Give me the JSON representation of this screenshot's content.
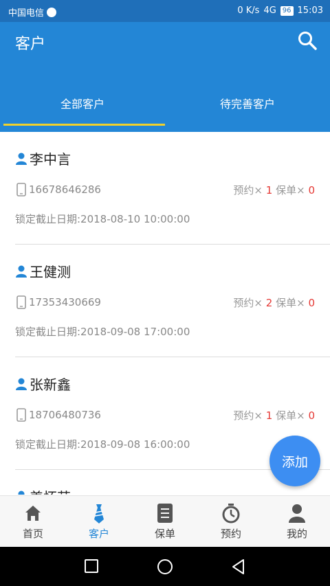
{
  "status_bar": {
    "carrier": "中国电信",
    "net_speed": "0 K/s",
    "signal": "4G",
    "battery": "96",
    "time": "15:03"
  },
  "header": {
    "title": "客户",
    "search_icon": "search-icon",
    "tabs": [
      {
        "label": "全部客户",
        "active": true
      },
      {
        "label": "待完善客户",
        "active": false
      }
    ]
  },
  "customers": [
    {
      "name": "李中言",
      "phone": "16678646286",
      "appointment_label": "预约×",
      "appointments": "1",
      "policy_label": "保单×",
      "policies": "0",
      "deadline": "锁定截止日期:2018-08-10 10:00:00"
    },
    {
      "name": "王健测",
      "phone": "17353430669",
      "appointment_label": "预约×",
      "appointments": "2",
      "policy_label": "保单×",
      "policies": "0",
      "deadline": "锁定截止日期:2018-09-08 17:00:00"
    },
    {
      "name": "张新鑫",
      "phone": "18706480736",
      "appointment_label": "预约×",
      "appointments": "1",
      "policy_label": "保单×",
      "policies": "0",
      "deadline": "锁定截止日期:2018-09-08 16:00:00"
    },
    {
      "name": "姜怀芸",
      "phone": "",
      "appointment_label": "",
      "appointments": "",
      "policy_label": "",
      "policies": "",
      "deadline": ""
    }
  ],
  "fab": {
    "label": "添加"
  },
  "tab_bar": {
    "items": [
      {
        "label": "首页",
        "icon": "home-icon",
        "active": false
      },
      {
        "label": "客户",
        "icon": "tie-icon",
        "active": true
      },
      {
        "label": "保单",
        "icon": "document-icon",
        "active": false
      },
      {
        "label": "预约",
        "icon": "stopwatch-icon",
        "active": false
      },
      {
        "label": "我的",
        "icon": "person-icon",
        "active": false
      }
    ]
  },
  "colors": {
    "header_blue": "#2386d6",
    "status_blue": "#1f6fb9",
    "tab_indicator": "#f2d12a",
    "count_red": "#e53935",
    "fab_blue": "#3d8ef2"
  }
}
